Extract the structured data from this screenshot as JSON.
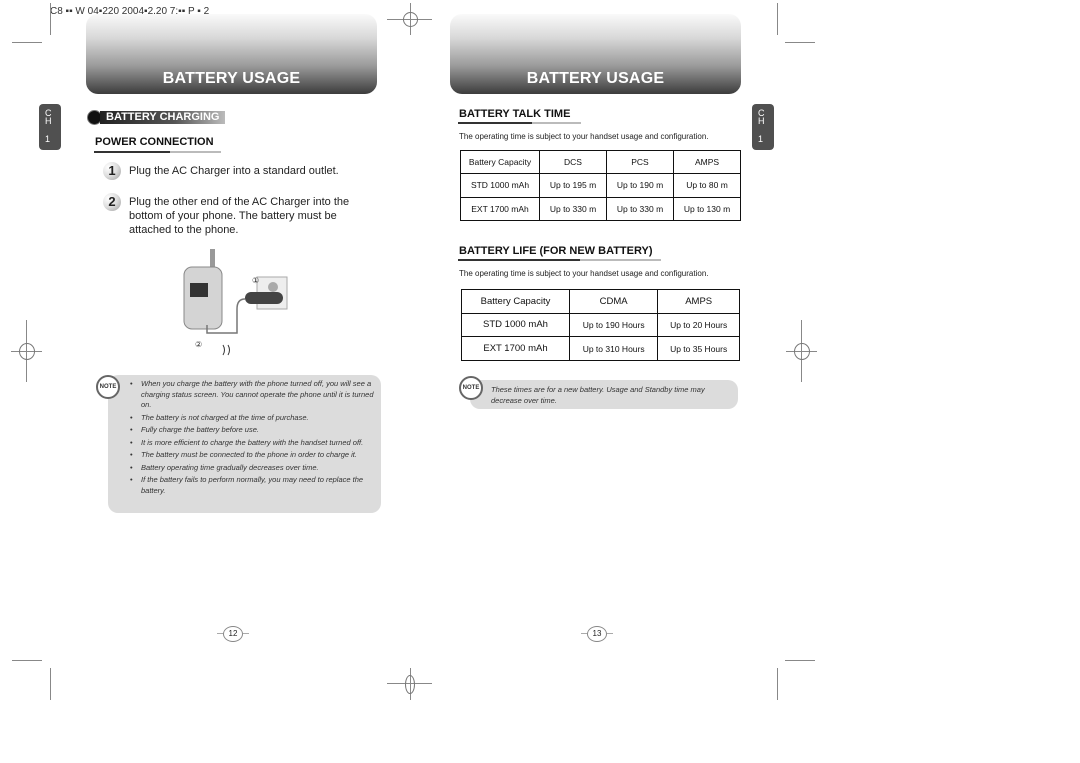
{
  "print_header": "C8 ▪▪ W 04▪220  2004▪2.20 7:▪▪ P ▪ 2",
  "left_page": {
    "banner_title": "BATTERY USAGE",
    "chapter_tab": {
      "c": "C",
      "h": "H",
      "num": "1"
    },
    "section_badge": "BATTERY CHARGING",
    "subheading": "POWER CONNECTION",
    "steps": [
      {
        "num": "1",
        "text": "Plug the AC Charger into a standard outlet."
      },
      {
        "num": "2",
        "text": "Plug the other end of the AC Charger into the bottom of your phone. The battery must be attached to the phone."
      }
    ],
    "illustration": {
      "callout_1": "①",
      "callout_2": "②",
      "description": "phone-charger-illustration"
    },
    "note": {
      "icon_label": "NOTE",
      "items": [
        "When you charge the battery with the phone turned off, you will see a charging status screen. You cannot operate the phone until it is turned on.",
        "The battery is not charged at the time of purchase.",
        "Fully charge the battery before use.",
        "It is more efficient to charge the battery with the handset turned off.",
        "The battery must be connected to the phone in order to charge it.",
        "Battery operating time gradually decreases over time.",
        "If the battery fails to perform normally, you may need to replace the battery."
      ]
    },
    "page_number": "12"
  },
  "right_page": {
    "banner_title": "BATTERY USAGE",
    "chapter_tab": {
      "c": "C",
      "h": "H",
      "num": "1"
    },
    "talk_time": {
      "heading": "BATTERY TALK TIME",
      "intro": "The operating time is subject to your handset usage and configuration.",
      "headers": [
        "Battery Capacity",
        "DCS",
        "PCS",
        "AMPS"
      ],
      "rows": [
        [
          "STD 1000 mAh",
          "Up to 195 m",
          "Up to 190 m",
          "Up to 80 m"
        ],
        [
          "EXT 1700 mAh",
          "Up to 330 m",
          "Up to 330 m",
          "Up to 130 m"
        ]
      ]
    },
    "battery_life": {
      "heading": "BATTERY LIFE (FOR NEW BATTERY)",
      "intro": "The operating time is subject to your handset usage and configuration.",
      "headers": [
        "Battery Capacity",
        "CDMA",
        "AMPS"
      ],
      "rows": [
        [
          "STD 1000 mAh",
          "Up to 190 Hours",
          "Up to 20 Hours"
        ],
        [
          "EXT 1700 mAh",
          "Up to 310 Hours",
          "Up to 35 Hours"
        ]
      ]
    },
    "note": {
      "icon_label": "NOTE",
      "text": "These times are for a new battery. Usage and Standby time may decrease over time."
    },
    "page_number": "13"
  }
}
